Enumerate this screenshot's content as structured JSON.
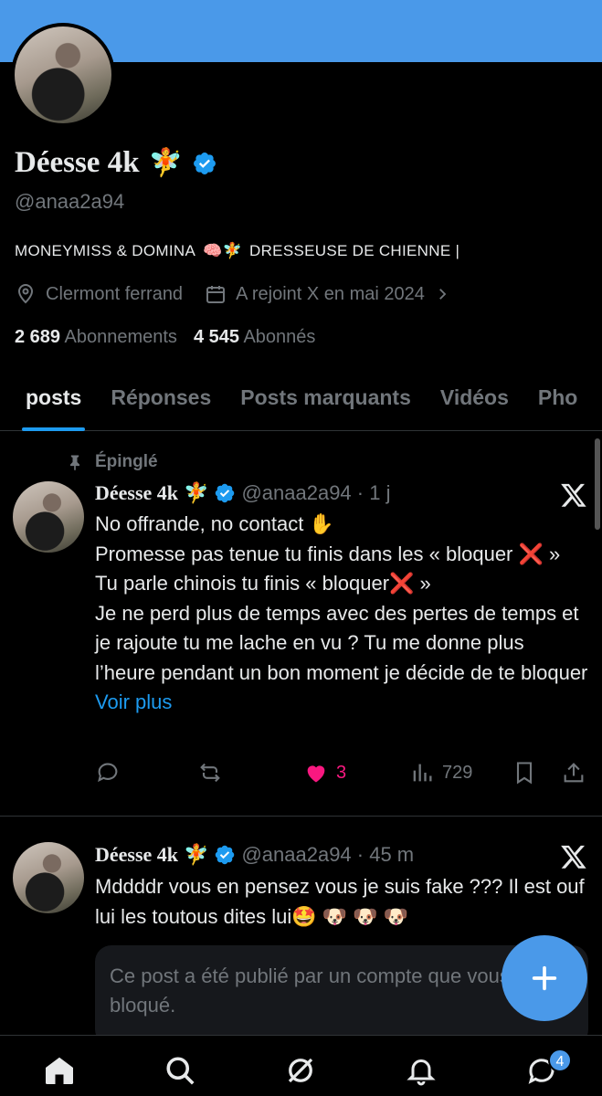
{
  "profile": {
    "display_name": "Déesse 4k",
    "name_emoji": "🧚",
    "handle": "@anaa2a94",
    "bio": {
      "part1": "MONEYMISS & DOMINA",
      "emoji": "🧠🧚",
      "part2": "DRESSEUSE DE CHIENNE |"
    },
    "location": "Clermont ferrand",
    "joined": "A rejoint X en mai 2024",
    "following_count": "2 689",
    "following_label": "Abonnements",
    "followers_count": "4 545",
    "followers_label": "Abonnés"
  },
  "tabs": [
    {
      "label": "posts"
    },
    {
      "label": "Réponses"
    },
    {
      "label": "Posts marquants"
    },
    {
      "label": "Vidéos"
    },
    {
      "label": "Pho"
    }
  ],
  "posts": [
    {
      "pinned_label": "Épinglé",
      "author": "Déesse 4k",
      "emoji": "🧚",
      "handle_time": "@anaa2a94 · 1 j",
      "text": "No offrande, no contact ✋\nPromesse pas tenue tu finis dans les « bloquer ❌ »\nTu parle chinois tu finis « bloquer❌ »\nJe ne perd plus de temps avec des pertes de temps et je rajoute tu me lache en vu ? Tu me donne plus l’heure pendant un bon moment je décide de te bloquer",
      "more_label": "Voir plus",
      "likes": "3",
      "views": "729"
    },
    {
      "author": "Déesse 4k",
      "emoji": "🧚",
      "handle_time": "@anaa2a94 · 45 m",
      "text": "Mddddr vous en pensez vous je suis fake ??? Il est ouf lui les toutous dites lui🤩 🐶 🐶 🐶",
      "blocked_notice": "Ce post a été publié par un compte que vous avez bloqué."
    }
  ],
  "nav": {
    "messages_badge": "4"
  },
  "colors": {
    "accent": "#1d9bf0",
    "banner": "#4a99e9",
    "like": "#f91880"
  }
}
